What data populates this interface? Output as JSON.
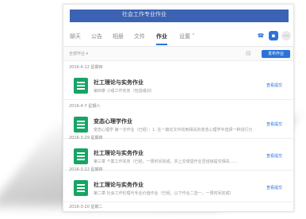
{
  "window": {
    "title": "社会工作专业作业"
  },
  "tabs": [
    {
      "label": "聊天"
    },
    {
      "label": "公告"
    },
    {
      "label": "相册"
    },
    {
      "label": "文件"
    },
    {
      "label": "作业"
    },
    {
      "label": "设置 ˅"
    }
  ],
  "toolbar": {
    "filter_label": "全部作业 ▾",
    "publish_label": "发布作业"
  },
  "homework": [
    {
      "date": "2016-4-12 星期四",
      "title": "社工理论与实务作业",
      "desc": "第四章 小组工作实务（包括组训）",
      "action": "查看提交"
    },
    {
      "date": "2016-4-7 星期六",
      "title": "变态心理学作业",
      "desc": "变态心理学 第一次作业（已经）：1. 在一篇论文中找到相关的变态心理学中选择一种进行分析……",
      "action": "查看提交"
    },
    {
      "date": "2016-3-29 星期四",
      "title": "社工理论与实务作业",
      "desc": "第三章 个案工作实务（已经，一周时间完成，并上交课堂作业至班级提交相关……",
      "action": "查看提交"
    },
    {
      "date": "2016-3-22 星期四",
      "title": "社工理论与实务作业",
      "desc": "第二章 社会工作伦理与专业价值作业（已经，以下作业二选一，一周时间完成）",
      "action": "查看提交"
    }
  ],
  "footer_date": "2016-3-20 星期二",
  "colors": {
    "accent": "#2a73d9",
    "file_icon": "#16a564",
    "titlebar": "#3c63b3"
  },
  "icons": [
    "phone-icon",
    "chat-icon",
    "more-icon",
    "document-icon",
    "excel-file-icon"
  ]
}
